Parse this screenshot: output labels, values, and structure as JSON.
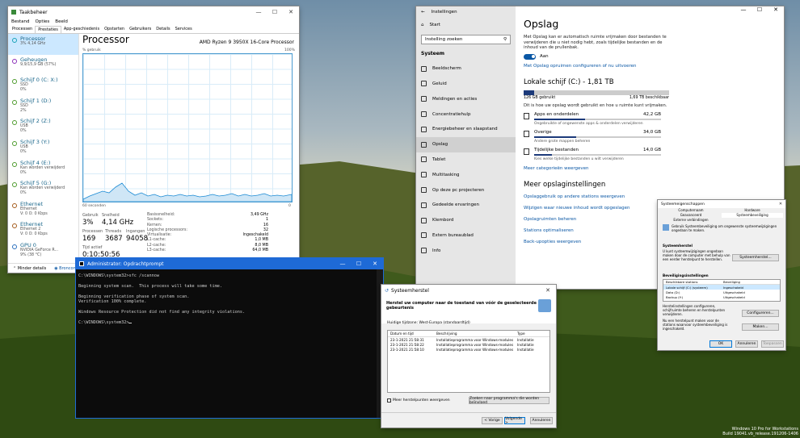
{
  "taskmgr": {
    "title": "Taakbeheer",
    "menu": [
      "Bestand",
      "Opties",
      "Beeld"
    ],
    "tabs": [
      "Processen",
      "Prestaties",
      "App-geschiedenis",
      "Opstarten",
      "Gebruikers",
      "Details",
      "Services"
    ],
    "items": [
      {
        "name": "Processor",
        "l1": "3% 4,14 GHz",
        "l2": ""
      },
      {
        "name": "Geheugen",
        "l1": "9,9/15,9 GB (57%)",
        "l2": ""
      },
      {
        "name": "Schijf 0 (C: X:)",
        "l1": "SSD",
        "l2": "0%"
      },
      {
        "name": "Schijf 1 (D:)",
        "l1": "SSD",
        "l2": "2%"
      },
      {
        "name": "Schijf 2 (Z:)",
        "l1": "USB",
        "l2": "0%"
      },
      {
        "name": "Schijf 3 (Y:)",
        "l1": "USB",
        "l2": "0%"
      },
      {
        "name": "Schijf 4 (E:)",
        "l1": "Kan worden verwijderd",
        "l2": "0%"
      },
      {
        "name": "Schijf 5 (G:)",
        "l1": "Kan worden verwijderd",
        "l2": "0%"
      },
      {
        "name": "Ethernet",
        "l1": "Ethernet",
        "l2": "V: 0 O: 0 Kbps"
      },
      {
        "name": "Ethernet",
        "l1": "Ethernet 2",
        "l2": "V: 0 O: 0 Kbps"
      },
      {
        "name": "GPU 0",
        "l1": "NVIDIA GeForce R...",
        "l2": "9% (38 °C)"
      }
    ],
    "heading": "Processor",
    "cpu": "AMD Ryzen 9 3950X 16-Core Processor",
    "graph_label_tl": "% gebruik",
    "graph_label_tr": "100%",
    "graph_label_bl": "60 seconden",
    "graph_label_br": "0",
    "usage_label": "Gebruik",
    "usage": "3%",
    "speed_label": "Snelheid",
    "speed": "4,14 GHz",
    "proc_label": "Processen",
    "proc": "169",
    "threads_label": "Threads",
    "threads": "3687",
    "handles_label": "Ingangen",
    "handles": "94058",
    "uptime_label": "Tijd actief",
    "uptime": "0:10:50:56",
    "specs": [
      [
        "Basissnelheid:",
        "3,49 GHz"
      ],
      [
        "Sockets:",
        "1"
      ],
      [
        "Kernen:",
        "16"
      ],
      [
        "Logische processors:",
        "32"
      ],
      [
        "Virtualisatie:",
        "Ingeschakeld"
      ],
      [
        "L1-cache:",
        "1,0 MB"
      ],
      [
        "L2-cache:",
        "8,0 MB"
      ],
      [
        "L3-cache:",
        "64,0 MB"
      ]
    ],
    "footer_less": "Minder details",
    "footer_monitor": "Broncontrole"
  },
  "settings": {
    "title": "Instellingen",
    "home": "Start",
    "search_placeholder": "Instelling zoeken",
    "section": "Systeem",
    "nav": [
      "Beeldscherm",
      "Geluid",
      "Meldingen en acties",
      "Concentratiehulp",
      "Energiebeheer en slaapstand",
      "Opslag",
      "Tablet",
      "Multitasking",
      "Op deze pc projecteren",
      "Gedeelde ervaringen",
      "Klembord",
      "Extern bureaublad",
      "Info"
    ],
    "heading": "Opslag",
    "intro": "Met Opslag kan er automatisch ruimte vrijmaken door bestanden te verwijderen die u niet nodig hebt, zoals tijdelijke bestanden en de inhoud van de prullenbak.",
    "toggle": "Aan",
    "configure": "Met Opslag opruimen configureren of nu uitvoeren",
    "drive": "Lokale schijf (C:) - 1,81 TB",
    "used": "126 GB gebruikt",
    "free": "1,69 TB beschikbaar",
    "used_fraction": 0.07,
    "usage_desc": "Dit is hoe uw opslag wordt gebruikt en hoe u ruimte kunt vrijmaken.",
    "cats": [
      {
        "name": "Apps en onderdelen",
        "size": "42,2 GB",
        "sub": "Ongebruikte of ongewenste apps & onderdelen verwijderen",
        "frac": 0.4
      },
      {
        "name": "Overige",
        "size": "34,0 GB",
        "sub": "Andere grote mappen beheren",
        "frac": 0.33
      },
      {
        "name": "Tijdelijke bestanden",
        "size": "14,0 GB",
        "sub": "Kies welke tijdelijke bestanden u wilt verwijderen",
        "frac": 0.14
      }
    ],
    "more_cats": "Meer categorieën weergeven",
    "more_heading": "Meer opslaginstellingen",
    "links": [
      "Opslaggebruik op andere stations weergeven",
      "Wijzigen waar nieuwe inhoud wordt opgeslagen",
      "Opslagruimten beheren",
      "Stations optimaliseren",
      "Back-upopties weergeven"
    ]
  },
  "cmd": {
    "title": "Administrator: Opdrachtprompt",
    "lines": [
      "C:\\WINDOWS\\system32>sfc /scannow",
      "",
      "Beginning system scan.  This process will take some time.",
      "",
      "Beginning verification phase of system scan.",
      "Verification 100% complete.",
      "",
      "Windows Resource Protection did not find any integrity violations.",
      "",
      "C:\\WINDOWS\\system32>"
    ]
  },
  "restore": {
    "title": "Systeemherstel",
    "heading": "Herstel uw computer naar de toestand van vóór de geselecteerde gebeurtenis",
    "tz": "Huidige tijdzone: West-Europa (standaardtijd)",
    "cols": [
      "Datum en tijd",
      "Beschrijving",
      "Type"
    ],
    "rows": [
      [
        "23-1-2021 21:58:31",
        "Installatieprogramma voor Windows-modules",
        "Installatie"
      ],
      [
        "23-1-2021 21:58:22",
        "Installatieprogramma voor Windows-modules",
        "Installatie"
      ],
      [
        "23-1-2021 21:58:10",
        "Installatieprogramma voor Windows-modules",
        "Installatie"
      ]
    ],
    "more": "Meer herstelpunten weergeven",
    "scan": "Zoeken naar programma's die worden beïnvloed",
    "back": "< Vorige",
    "next": "Volgende >",
    "cancel": "Annuleren"
  },
  "sysprops": {
    "title": "Systeemeigenschappen",
    "tabs": [
      "Computernaam",
      "Hardware",
      "Geavanceerd",
      "Systeembeveiliging",
      "Externe verbindingen"
    ],
    "desc": "Gebruik Systeembeveiliging om ongewenste systeemwijzigingen ongedaan te maken.",
    "g1": "Systeemherstel",
    "g1_text": "U kunt systeemwijzigingen ongedaan maken door de computer met behulp van een eerder herstelpunt te herstellen.",
    "g1_btn": "Systeemherstel...",
    "g2": "Beveiligingsinstellingen",
    "cols": [
      "Beschikbare stations",
      "Beveiliging"
    ],
    "drives": [
      [
        "Lokale schijf (C:) (systeem)",
        "Ingeschakeld"
      ],
      [
        "Data (D:)",
        "Uitgeschakeld"
      ],
      [
        "Backup (Y:)",
        "Uitgeschakeld"
      ]
    ],
    "cfg_text": "Herstelinstellingen configureren, schijfruimte beheren en herstelpunten verwijderen.",
    "cfg_btn": "Configureren...",
    "mk_text": "Nu een herstelpunt maken voor de stations waarvoor systeembeveiliging is ingeschakeld.",
    "mk_btn": "Maken...",
    "ok": "OK",
    "cancel": "Annuleren",
    "apply": "Toepassen"
  },
  "watermark": {
    "l1": "Windows 10 Pro for Workstations",
    "l2": "Build 19041.vb_release.191206-1406"
  }
}
